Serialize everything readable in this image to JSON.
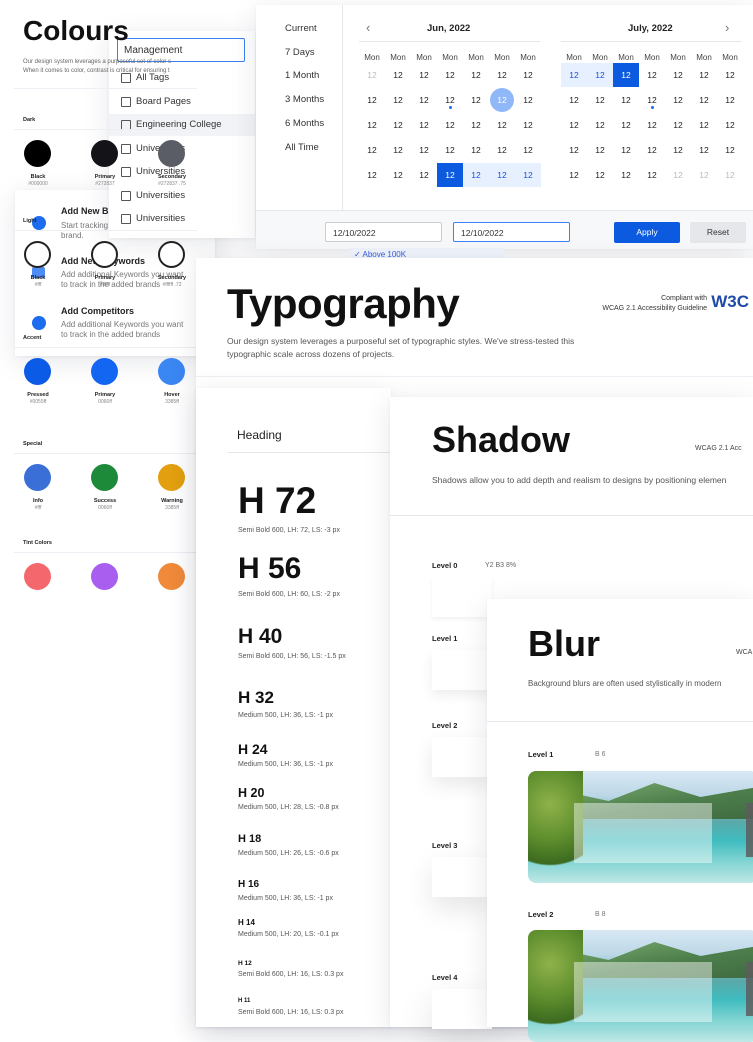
{
  "management_dropdown": {
    "value": "Management",
    "options": [
      {
        "label": "All Tags"
      },
      {
        "label": "Board Pages"
      },
      {
        "label": "Engineering College",
        "highlighted": true
      },
      {
        "label": "Universities"
      },
      {
        "label": "Universities"
      },
      {
        "label": "Universities"
      },
      {
        "label": "Universities"
      }
    ]
  },
  "date_picker": {
    "presets": [
      "Current",
      "7 Days",
      "1 Month",
      "3 Months",
      "6 Months",
      "All Time"
    ],
    "months": [
      {
        "title": "Jun, 2022",
        "weekday": "Mon",
        "day": "12"
      },
      {
        "title": "July, 2022",
        "weekday": "Mon",
        "day": "12"
      }
    ],
    "start_date": "12/10/2022",
    "end_date": "12/10/2022",
    "apply_label": "Apply",
    "reset_label": "Reset",
    "filter_chip": "✓  Above 100K"
  },
  "add_panel": {
    "items": [
      {
        "title": "Add New B",
        "desc": [
          "Start tracking",
          "brand."
        ],
        "icon": "plus-circle-icon"
      },
      {
        "title": "Add New Keywords",
        "desc": [
          "Add additional Keywords you want",
          "to track in the added brands"
        ],
        "icon": "keyword-card-icon"
      },
      {
        "title": "Add Competitors",
        "desc": [
          "Add additional Keywords you want",
          "to track in the added brands"
        ],
        "icon": "globe-icon"
      }
    ]
  },
  "colours": {
    "title": "Colours",
    "desc": [
      "Our design system leverages a purposeful set of color s",
      "When it comes to color, contrast is critical for ensuring t"
    ],
    "sections": [
      {
        "label": "Dark",
        "swatches": [
          {
            "name": "Black",
            "value": "#000000",
            "color": "#000000"
          },
          {
            "name": "Primary",
            "value": "#272837",
            "color": "#141418"
          },
          {
            "name": "Secondary",
            "value": "#272837 .75",
            "color": "#5b5d66"
          }
        ]
      },
      {
        "label": "Light",
        "swatches": [
          {
            "name": "Black",
            "value": "#fff",
            "color": "#ffffff"
          },
          {
            "name": "Primary",
            "value": "#ffffff",
            "color": "#ffffff"
          },
          {
            "name": "Secondary",
            "value": "#ffffff .72",
            "color": "#ffffff"
          }
        ]
      },
      {
        "label": "Accent",
        "swatches": [
          {
            "name": "Pressed",
            "value": "#0055ff",
            "color": "#0b5be6"
          },
          {
            "name": "Primary",
            "value": "0066ff",
            "color": "#1266f1"
          },
          {
            "name": "Hover",
            "value": "3385ff",
            "color": "#3a86f2"
          }
        ]
      },
      {
        "label": "Special",
        "swatches": [
          {
            "name": "Info",
            "value": "#fff",
            "color": "#3a6fd8"
          },
          {
            "name": "Success",
            "value": "0066ff",
            "color": "#1d8a3a"
          },
          {
            "name": "Warning",
            "value": "3385ff",
            "color": "#e2a010"
          }
        ]
      },
      {
        "label": "Tint Colors",
        "swatches": [
          {
            "name": "",
            "value": "",
            "color": "#f4686d"
          },
          {
            "name": "",
            "value": "",
            "color": "#a95ef0"
          },
          {
            "name": "",
            "value": "",
            "color": "#f08a3a"
          },
          {
            "name": "",
            "value": "",
            "color": "#e277e3"
          }
        ]
      }
    ]
  },
  "typography": {
    "title": "Typography",
    "desc": [
      "Our design system leverages a purposeful set of typographic styles. We've stress-tested this",
      "typographic scale across dozens of projects."
    ],
    "compliant_line1": "Compliant with",
    "compliant_line2": "WCAG 2.1 Accessibility Guideline",
    "w3c": "W3C",
    "heading_caption": "Heading",
    "scale": [
      {
        "label": "H 72",
        "meta": "Semi Bold 600, LH: 72, LS: -3 px"
      },
      {
        "label": "H 56",
        "meta": "Semi Bold 600, LH: 60, LS: -2 px"
      },
      {
        "label": "H 40",
        "meta": "Semi Bold 600, LH: 56, LS: -1.5 px"
      },
      {
        "label": "H 32",
        "meta": "Medium 500, LH: 36, LS: -1 px"
      },
      {
        "label": "H 24",
        "meta": "Medium 500, LH: 36, LS: -1 px"
      },
      {
        "label": "H 20",
        "meta": "Medium 500, LH: 28, LS: -0.8 px"
      },
      {
        "label": "H 18",
        "meta": "Medium 500, LH: 26, LS: -0.6 px"
      },
      {
        "label": "H 16",
        "meta": "Medium 500, LH: 36, LS: -1 px"
      },
      {
        "label": "H 14",
        "meta": "Medium 500, LH: 20, LS: -0.1 px"
      },
      {
        "label": "H 12",
        "meta": "Semi Bold 600, LH: 16, LS: 0.3 px"
      },
      {
        "label": "H 11",
        "meta": "Semi Bold 600, LH: 16, LS: 0.3 px"
      }
    ]
  },
  "shadow": {
    "title": "Shadow",
    "wcag": "WCAG 2.1 Acc",
    "desc": "Shadows allow you to add depth and realism to designs by positioning elemen",
    "levels": [
      {
        "label": "Level 0",
        "value": "Y2 B3 8%"
      },
      {
        "label": "Level 1",
        "value": ""
      },
      {
        "label": "Level 2",
        "value": ""
      },
      {
        "label": "Level 3",
        "value": ""
      },
      {
        "label": "Level 4",
        "value": ""
      }
    ]
  },
  "blur": {
    "title": "Blur",
    "wcag": "WCA",
    "desc": "Background blurs are often used stylistically in modern",
    "levels": [
      {
        "label": "Level 1",
        "value": "B 6"
      },
      {
        "label": "Level 2",
        "value": "B 8"
      }
    ]
  }
}
